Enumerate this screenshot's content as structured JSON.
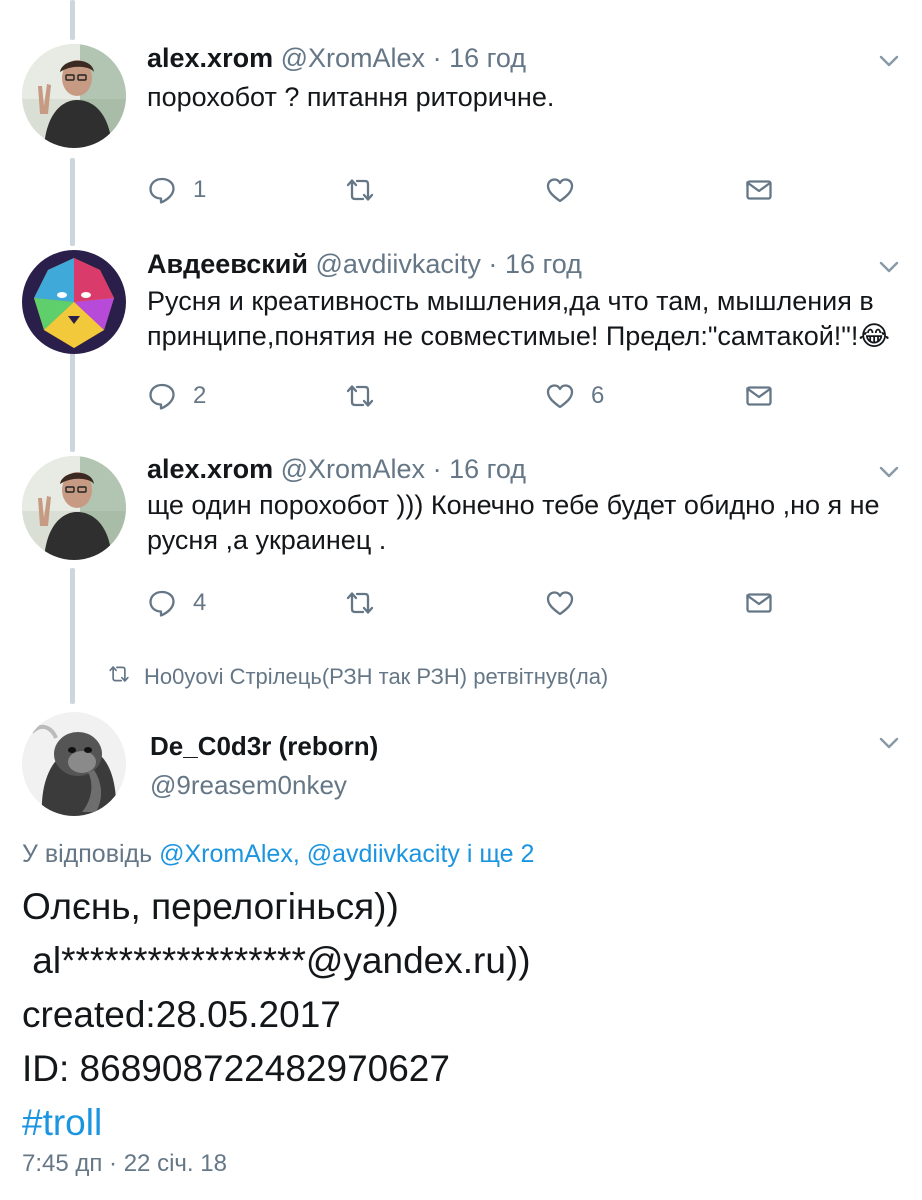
{
  "tweets": [
    {
      "name": "alex.xrom",
      "handle": "@XromAlex",
      "separator": "·",
      "time": "16 год",
      "text": "порохобот ? питання риторичне.",
      "replies": "1",
      "retweets": "",
      "likes": ""
    },
    {
      "name": "Авдеевский",
      "handle": "@avdiivkacity",
      "separator": "·",
      "time": "16 год",
      "text": "Русня и креативность мышления,да что там, мышления в принципе,понятия не совместимые! Предел:\"самтакой!\"!😂",
      "replies": "2",
      "retweets": "",
      "likes": "6"
    },
    {
      "name": "alex.xrom",
      "handle": "@XromAlex",
      "separator": "·",
      "time": "16 год",
      "text": "ще один порохобот ))) Конечно тебе будет обидно ,но я не русня ,а украинец .",
      "replies": "4",
      "retweets": "",
      "likes": ""
    }
  ],
  "retweet_note": "Ho0yovi Стрілець(РЗН так РЗН) ретвітнув(ла)",
  "main_tweet": {
    "name": "De_C0d3r (reborn)",
    "handle": "@9reasem0nkey",
    "reply_prefix": "У відповідь",
    "reply_users": "@XromAlex, @avdiivkacity",
    "reply_suffix": "і ще 2",
    "lines": [
      "Олєнь, перелогінься))",
      " al*****************@yandex.ru))",
      "created:28.05.2017",
      "ID: 868908722482970627"
    ],
    "hashtag": "#troll",
    "timestamp": "7:45 дп · 22 січ. 18"
  },
  "icons": {
    "reply": "reply-icon",
    "retweet": "retweet-icon",
    "like": "heart-icon",
    "dm": "mail-icon",
    "caret": "chevron-down-icon"
  },
  "colors": {
    "text": "#14171a",
    "secondary": "#657786",
    "link": "#1b95e0",
    "thread_line": "#ccd6dd"
  }
}
